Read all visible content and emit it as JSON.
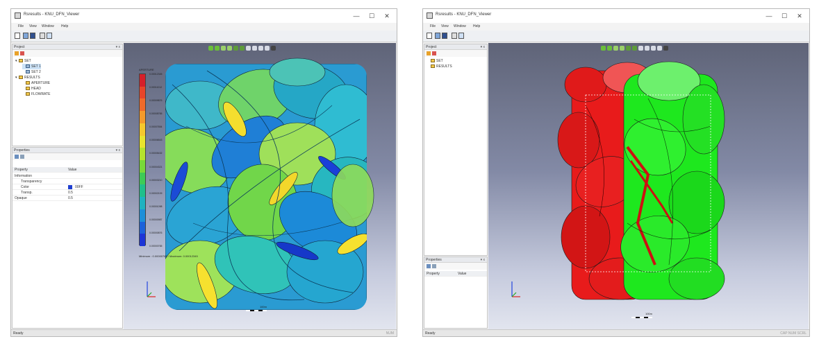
{
  "windows": [
    {
      "title": "Rsresults - KNU_DFN_Viewer",
      "menu": [
        "File",
        "View",
        "Window",
        "Help"
      ],
      "controls": {
        "minimize": "—",
        "maximize": "☐",
        "close": "✕"
      },
      "project_panel": {
        "title": "Project",
        "pins": "▾ x",
        "tree": [
          {
            "label": "SET",
            "indent": 0,
            "expanded": true,
            "type": "folder"
          },
          {
            "label": "SET 1",
            "indent": 1,
            "selected": true,
            "type": "set"
          },
          {
            "label": "SET 2",
            "indent": 1,
            "type": "set"
          },
          {
            "label": "RESULTS",
            "indent": 0,
            "expanded": true,
            "type": "folder"
          },
          {
            "label": "APERTURE",
            "indent": 1,
            "type": "folder"
          },
          {
            "label": "HEAD",
            "indent": 1,
            "type": "folder"
          },
          {
            "label": "FLOWRATE",
            "indent": 1,
            "type": "folder"
          }
        ]
      },
      "properties_panel": {
        "title": "Properties",
        "pins": "▾ x",
        "headers": {
          "property": "Property",
          "value": "Value"
        },
        "rows": [
          {
            "property": "Information",
            "value": ""
          },
          {
            "property": "Transparency",
            "value": ""
          },
          {
            "property": "Color",
            "value": "00FF"
          },
          {
            "property": "Transp.",
            "value": "0.5"
          },
          {
            "property": "Opaque",
            "value": "0.5"
          }
        ],
        "color_swatch": "#1f3fd0"
      },
      "legend": {
        "title": "APERTURE",
        "labels": [
          "0.00012345",
          "0.00011012",
          "0.00009876",
          "0.00008765",
          "0.00007654",
          "0.00006543",
          "0.00005432",
          "0.00004321",
          "0.00003210",
          "0.00002109",
          "0.00001098",
          "0.00000987",
          "0.00000876",
          "0.00000765"
        ],
        "footer": "Minimum : 0.00000765 / Maximum: 0.00012345",
        "colors": [
          "#d6202a",
          "#e7452a",
          "#f06a2a",
          "#f49a2c",
          "#f6c82d",
          "#e9e42e",
          "#b5e32d",
          "#78d93a",
          "#3dcb57",
          "#20bf8b",
          "#1fb2c0",
          "#1d8fd8",
          "#1c62da",
          "#1c35d6"
        ]
      },
      "scale_label": "100m",
      "status": "Ready",
      "status_right": "NUM"
    },
    {
      "title": "Rsresults - KNU_DFN_Viewer",
      "menu": [
        "File",
        "View",
        "Window",
        "Help"
      ],
      "controls": {
        "minimize": "—",
        "maximize": "☐",
        "close": "✕"
      },
      "project_panel": {
        "title": "Project",
        "pins": "▾ x",
        "tree": [
          {
            "label": "SET",
            "indent": 0,
            "type": "folder"
          },
          {
            "label": "RESULTS",
            "indent": 0,
            "type": "folder"
          }
        ]
      },
      "properties_panel": {
        "title": "Properties",
        "pins": "▾ x",
        "headers": {
          "property": "Property",
          "value": "Value"
        },
        "rows": []
      },
      "scale_label": "100m",
      "status": "Ready",
      "status_right": "CAP NUM SCRL"
    }
  ]
}
